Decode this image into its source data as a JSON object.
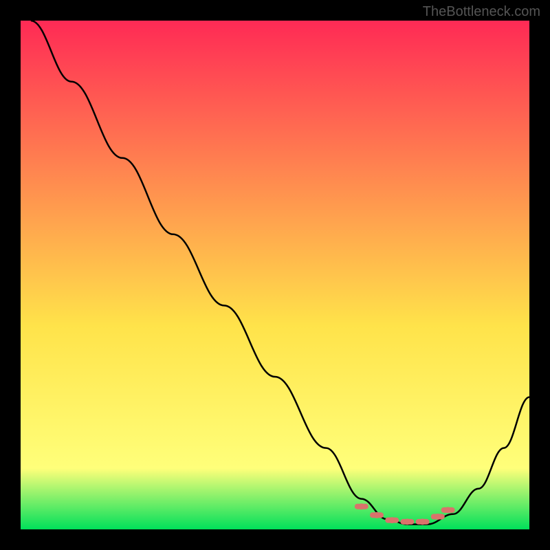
{
  "watermark": "TheBottleneck.com",
  "chart_data": {
    "type": "line",
    "title": "",
    "xlabel": "",
    "ylabel": "",
    "xlim": [
      0,
      100
    ],
    "ylim": [
      0,
      100
    ],
    "background_gradient": [
      "#ff2a55",
      "#ffe34a",
      "#00e05a"
    ],
    "series": [
      {
        "name": "bottleneck-curve",
        "x": [
          2,
          10,
          20,
          30,
          40,
          50,
          60,
          67,
          72,
          76,
          80,
          85,
          90,
          95,
          100
        ],
        "values": [
          100,
          88,
          73,
          58,
          44,
          30,
          16,
          6,
          2,
          1,
          1,
          3,
          8,
          16,
          26
        ]
      }
    ],
    "markers": {
      "name": "highlight-band",
      "color": "#d9736b",
      "x": [
        67,
        70,
        73,
        76,
        79,
        82,
        84
      ],
      "values": [
        4.5,
        2.8,
        1.8,
        1.5,
        1.5,
        2.5,
        3.8
      ]
    }
  }
}
